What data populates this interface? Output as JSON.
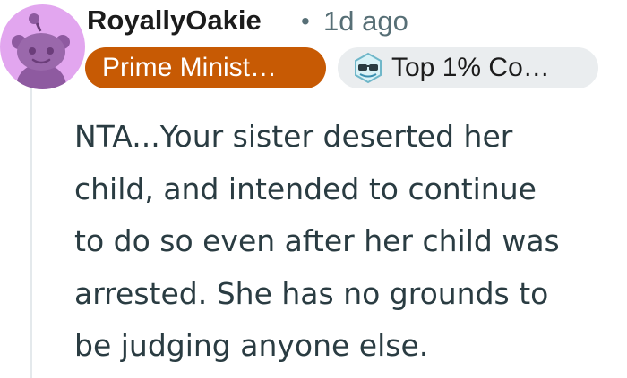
{
  "comment": {
    "author": "RoyallyOakie",
    "separator": "•",
    "timestamp": "1d ago",
    "avatar_icon": "reddit-snoo-avatar-icon",
    "flairs": [
      {
        "label": "Prime Minist…",
        "background": "#c75a04",
        "color": "#ffffff"
      },
      {
        "label": "Top 1% Co…",
        "icon": "sunglasses-badge-icon",
        "background": "#eaedef",
        "color": "#1c1c1c"
      }
    ],
    "body_lines": [
      "NTA...Your sister deserted her",
      "child, and intended to continue",
      "to do so even after her child was",
      "arrested. She has no grounds to",
      "be judging anyone else."
    ]
  },
  "colors": {
    "avatar_bg": "#e2a6ef",
    "meta_text": "#576f76",
    "thread_line": "#e4e9ec"
  }
}
